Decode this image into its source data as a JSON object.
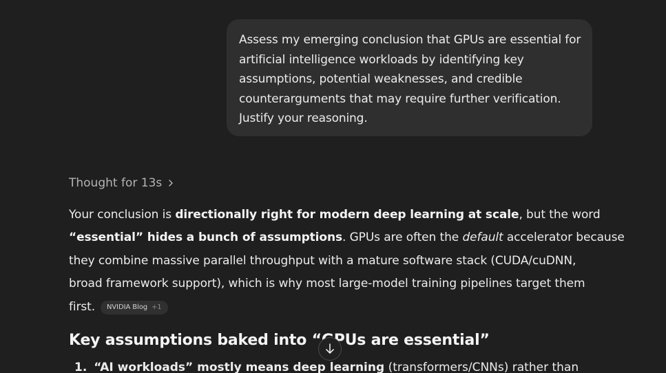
{
  "user_prompt": {
    "lines": [
      "Assess my emerging conclusion that GPUs are essential for",
      "artificial intelligence workloads by identifying key",
      "assumptions, potential weaknesses, and credible",
      "counterarguments that may require further verification.",
      "Justify your reasoning."
    ]
  },
  "thought": {
    "label": "Thought for 13s"
  },
  "answer": {
    "l1_a": "Your conclusion is ",
    "l1_b": "directionally right for modern deep learning at scale",
    "l1_c": ", but the word",
    "l2_a": "“essential” hides a bunch of assumptions",
    "l2_b": ". GPUs are often the ",
    "l2_c": "default",
    "l2_d": " accelerator because",
    "l3": "they combine massive parallel throughput with a mature software stack (CUDA/cuDNN,",
    "l4": "broad framework support), which is why most large-model training pipelines target them",
    "l5": "first.",
    "citation_source": "NVIDIA Blog",
    "citation_more": "+1"
  },
  "heading": {
    "text": "Key assumptions baked into “GPUs are essential”"
  },
  "list": {
    "item1_num": "1.",
    "item1_bold": "“AI workloads” mostly means deep learning",
    "item1_rest": " (transformers/CNNs) rather than"
  },
  "icons": {
    "chevron": "chevron-right-icon",
    "scroll": "arrow-down-icon"
  },
  "colors": {
    "background": "#1f1f1f",
    "bubble": "#2f2f2f",
    "text": "#ececec",
    "muted": "#b4b4b4"
  }
}
